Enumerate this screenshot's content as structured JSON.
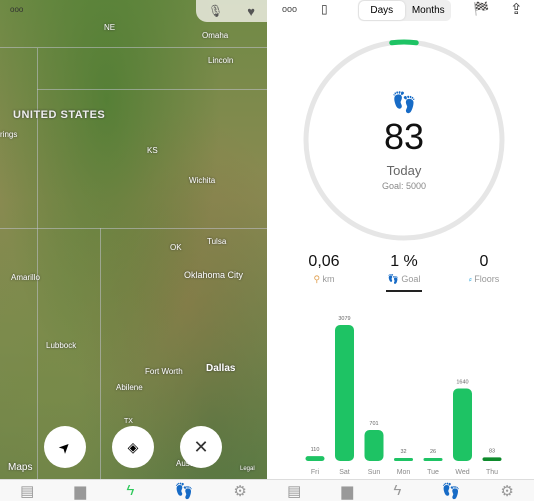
{
  "map": {
    "labels": {
      "ne": "NE",
      "omaha": "Omaha",
      "lincoln": "Lincoln",
      "us": "UNITED STATES",
      "rings": "rings",
      "ks": "KS",
      "wichita": "Wichita",
      "ok": "OK",
      "tulsa": "Tulsa",
      "amarillo": "Amarillo",
      "okc": "Oklahoma City",
      "lubbock": "Lubbock",
      "fortworth": "Fort Worth",
      "dallas": "Dallas",
      "abilene": "Abilene",
      "tx": "TX",
      "austin": "Austin"
    },
    "attribution": "Maps",
    "legal": "Legal",
    "more": "ooo"
  },
  "header": {
    "more": "ooo",
    "seg": [
      "Days",
      "Months"
    ],
    "selected": "Days"
  },
  "ring": {
    "steps": "83",
    "label": "Today",
    "goal": "Goal: 5000",
    "progress": 0.0166,
    "color": "#1ec364"
  },
  "stats": [
    {
      "value": "0,06",
      "label": "km"
    },
    {
      "value": "1 %",
      "label": "Goal"
    },
    {
      "value": "0",
      "label": "Floors"
    }
  ],
  "chart_data": {
    "type": "bar",
    "categories": [
      "Fri",
      "Sat",
      "Sun",
      "Mon",
      "Tue",
      "Wed",
      "Thu"
    ],
    "values": [
      110,
      3079,
      701,
      32,
      26,
      1640,
      83
    ],
    "labels": [
      "110",
      "3079",
      "701",
      "32",
      "26",
      "1640",
      "83"
    ],
    "color": "#1ec364",
    "highlight_color": "#0e8a2c"
  },
  "tabbar": [
    "clipboard-icon",
    "chart-icon",
    "bolt-icon",
    "footprints-icon",
    "gear-icon"
  ]
}
